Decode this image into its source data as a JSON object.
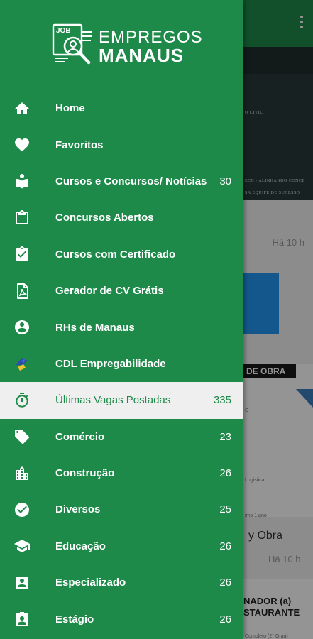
{
  "app": {
    "logo_line1": "EMPREGOS",
    "logo_line2": "MANAUS",
    "logo_mark_text": "JOB"
  },
  "colors": {
    "primary": "#1e8a4a",
    "active_bg": "#efefef",
    "text_on_primary": "#ffffff"
  },
  "menu": {
    "items": [
      {
        "label": "Home",
        "count": "",
        "icon": "home-icon"
      },
      {
        "label": "Favoritos",
        "count": "",
        "icon": "heart-icon"
      },
      {
        "label": "Cursos e Concursos/ Notícias",
        "count": "30",
        "icon": "reader-icon"
      },
      {
        "label": "Concursos Abertos",
        "count": "",
        "icon": "clipboard-icon"
      },
      {
        "label": "Cursos com Certificado",
        "count": "",
        "icon": "clipboard-check-icon"
      },
      {
        "label": "Gerador de CV Grátis",
        "count": "",
        "icon": "pdf-icon"
      },
      {
        "label": "RHs de Manaus",
        "count": "",
        "icon": "account-circle-icon"
      },
      {
        "label": "CDL Empregabilidade",
        "count": "",
        "icon": "cdl-logo-icon"
      },
      {
        "label": "Últimas Vagas Postadas",
        "count": "335",
        "icon": "timer-icon",
        "active": true
      },
      {
        "label": "Comércio",
        "count": "23",
        "icon": "tag-icon"
      },
      {
        "label": "Construção",
        "count": "26",
        "icon": "city-icon"
      },
      {
        "label": "Diversos",
        "count": "25",
        "icon": "check-circle-icon"
      },
      {
        "label": "Educação",
        "count": "26",
        "icon": "graduation-cap-icon"
      },
      {
        "label": "Especializado",
        "count": "26",
        "icon": "contact-card-icon"
      },
      {
        "label": "Estágio",
        "count": "26",
        "icon": "badge-icon"
      }
    ]
  },
  "background": {
    "time_label_1": "Há 10 h",
    "time_label_2": "Há 10 h",
    "banner_text": "DE OBRA",
    "title_fragment": "y Obra",
    "card_title_line1": "NADOR (a)",
    "card_title_line2": "STAURANTE",
    "faded_text_1": "O CIVIL",
    "faded_text_2": "ECC - ALINHANDO CONCE",
    "faded_text_3": "SA EQUIPE DE SUCESSO",
    "small_text_1": "Logistica",
    "small_text_2": "imo 1 ano",
    "small_text_3": "Completo (2° Grau)"
  }
}
